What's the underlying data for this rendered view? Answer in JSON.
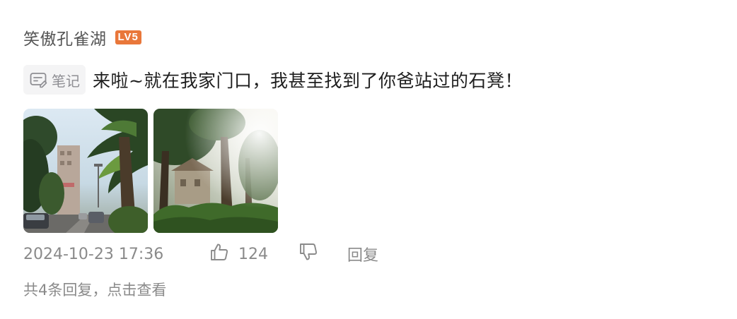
{
  "comment": {
    "username": "笑傲孔雀湖",
    "level_badge": "LV5",
    "tag_icon": "note-icon",
    "tag_label": "笔记",
    "text": "来啦~就在我家门口，我甚至找到了你爸站过的石凳！",
    "images": [
      {
        "name": "street-photo-1",
        "description_icon": "photo"
      },
      {
        "name": "street-photo-2",
        "description_icon": "photo"
      }
    ],
    "timestamp": "2024-10-23 17:36",
    "like_icon": "thumbs-up-icon",
    "like_count": "124",
    "dislike_icon": "thumbs-down-icon",
    "reply_label": "回复",
    "replies_summary": "共4条回复，点击查看"
  },
  "colors": {
    "badge": "#e9773a",
    "meta_text": "#8a8a8a",
    "username": "#555555"
  }
}
